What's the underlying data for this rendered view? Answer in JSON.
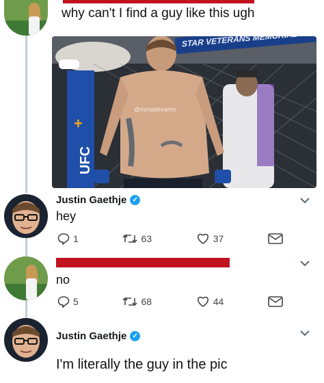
{
  "tweet1": {
    "text": "why can't I find a guy like this ugh",
    "media": {
      "banner_text": "STAR VETERANS MEMORIAL",
      "watermark": "@mmastreams"
    }
  },
  "reply1": {
    "display_name": "Justin Gaethje",
    "text": "hey",
    "replies": "1",
    "retweets": "63",
    "likes": "37"
  },
  "reply2": {
    "text": "no",
    "replies": "5",
    "retweets": "68",
    "likes": "44"
  },
  "reply3": {
    "display_name": "Justin Gaethje",
    "text": "I'm literally the guy in the pic"
  },
  "icons": [
    "verified-badge-icon",
    "chevron-down-icon",
    "reply-icon",
    "retweet-icon",
    "like-icon",
    "dm-icon"
  ],
  "colors": {
    "redaction": "#c1121f",
    "verified": "#1da1f2",
    "thread_line": "#c4cfd6"
  }
}
